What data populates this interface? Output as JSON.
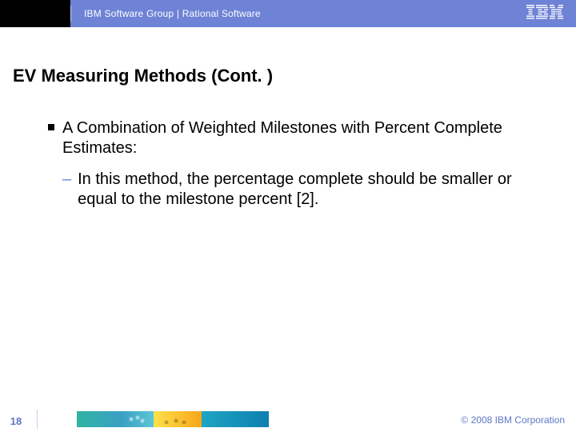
{
  "header": {
    "org": "IBM Software Group | Rational Software",
    "logo_name": "ibm-logo"
  },
  "slide": {
    "title": "EV Measuring Methods (Cont. )",
    "bullet1": "A Combination of Weighted Milestones with Percent Complete Estimates:",
    "sub1_marker": "–",
    "sub1": "In this method, the percentage complete should be smaller or equal to the milestone percent [2]."
  },
  "footer": {
    "page": "18",
    "copyright": "© 2008 IBM Corporation"
  }
}
